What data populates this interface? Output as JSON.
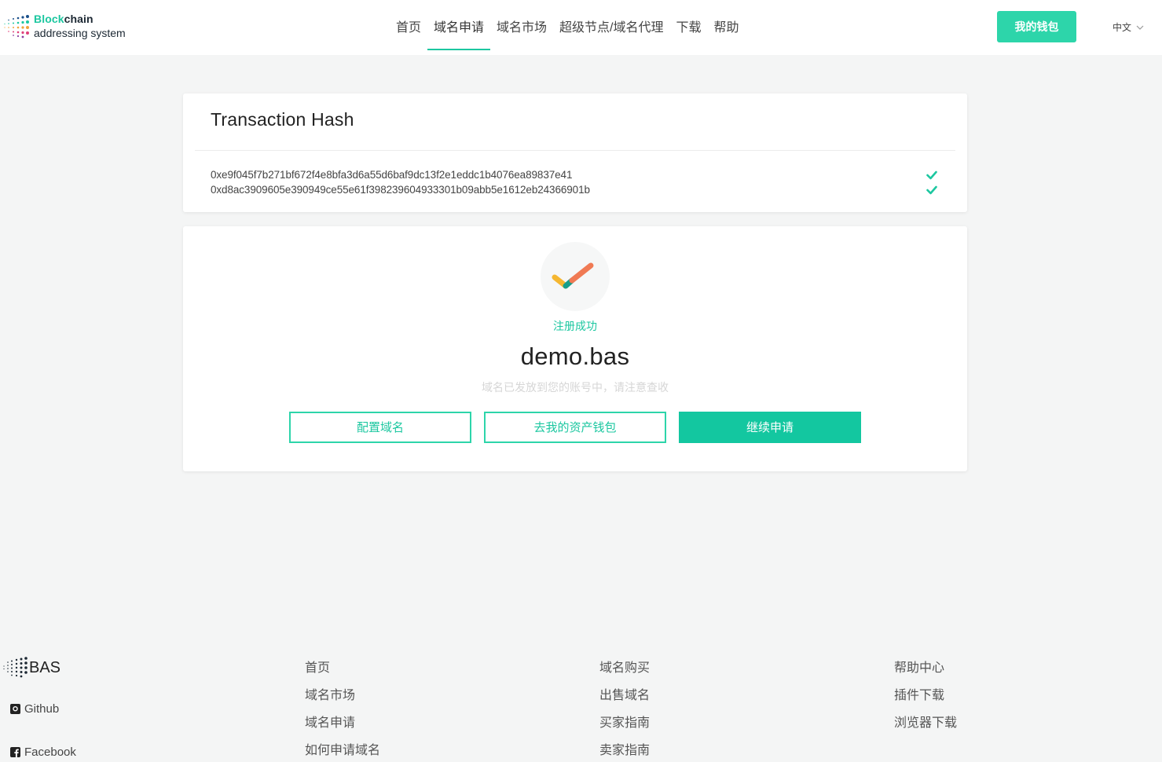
{
  "header": {
    "logo_line1_accent": "Block",
    "logo_line1_rest": "chain",
    "logo_line2": "addressing system",
    "nav": [
      "首页",
      "域名申请",
      "域名市场",
      "超级节点/域名代理",
      "下载",
      "帮助"
    ],
    "active_nav_index": 1,
    "wallet_button": "我的钱包",
    "language": "中文"
  },
  "transaction": {
    "title": "Transaction Hash",
    "hashes": [
      "0xe9f045f7b271bf672f4e8bfa3d6a55d6baf9dc13f2e1eddc1b4076ea89837e41",
      "0xd8ac3909605e390949ce55e61f398239604933301b09abb5e1612eb24366901b"
    ]
  },
  "result": {
    "status": "注册成功",
    "domain": "demo.bas",
    "notice": "域名已发放到您的账号中，请注意查收",
    "buttons": {
      "configure": "配置域名",
      "wallet": "去我的资产钱包",
      "continue": "继续申请"
    }
  },
  "footer": {
    "brand": "BAS",
    "github": "Github",
    "facebook": "Facebook",
    "col1": [
      "首页",
      "域名市场",
      "域名申请",
      "如何申请域名"
    ],
    "col2": [
      "域名购买",
      "出售域名",
      "买家指南",
      "卖家指南"
    ],
    "col3": [
      "帮助中心",
      "插件下载",
      "浏览器下载"
    ]
  },
  "colors": {
    "accent": "#1cc7a0",
    "button_fill": "#2dd5aa",
    "background": "#f4f5f5"
  }
}
